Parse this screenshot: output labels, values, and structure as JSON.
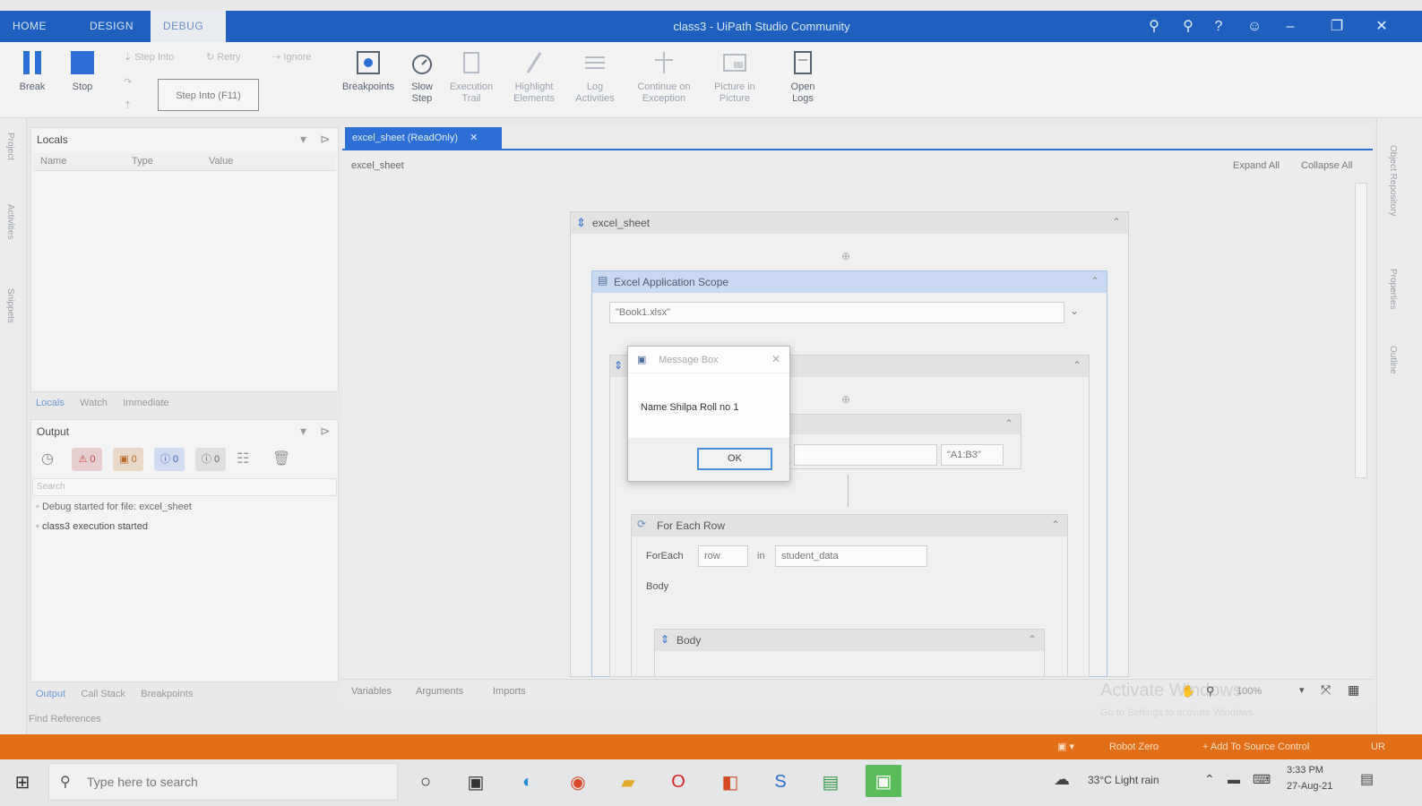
{
  "titlebar": {
    "tabs": [
      "HOME",
      "DESIGN",
      "DEBUG"
    ],
    "title": "class3 - UiPath Studio Community",
    "colors": {
      "bar": "#1f5fbf",
      "status": "#e26e17",
      "accent": "#2d6fd6"
    }
  },
  "ribbon": {
    "break_label": "Break",
    "stop_label": "Stop",
    "step_into": "Step Into",
    "retry": "Retry",
    "ignore": "Ignore",
    "tooltip": "Step Into (F11)",
    "breakpoints": "Breakpoints",
    "slow_step": [
      "Slow",
      "Step"
    ],
    "execution_trail": [
      "Execution",
      "Trail"
    ],
    "highlight_elements": [
      "Highlight",
      "Elements"
    ],
    "log_activities": [
      "Log",
      "Activities"
    ],
    "continue_on_exception": [
      "Continue on",
      "Exception"
    ],
    "picture_in_picture": [
      "Picture in",
      "Picture"
    ],
    "open_logs": [
      "Open",
      "Logs"
    ]
  },
  "left_strip": [
    "Project",
    "Activities",
    "Snippets"
  ],
  "right_strip": [
    "Object Repository",
    "Properties",
    "Outline"
  ],
  "locals": {
    "title": "Locals",
    "columns": [
      "Name",
      "Type",
      "Value"
    ],
    "tabs": [
      "Locals",
      "Watch",
      "Immediate"
    ]
  },
  "output": {
    "title": "Output",
    "counts": [
      "0",
      "0",
      "0",
      "0"
    ],
    "search_placeholder": "Search",
    "lines": [
      "Debug started for file: excel_sheet",
      "class3 execution started"
    ],
    "tabs": [
      "Output",
      "Call Stack",
      "Breakpoints"
    ],
    "find_references": "Find References"
  },
  "designer": {
    "doc_tab": "excel_sheet (ReadOnly)",
    "breadcrumb": "excel_sheet",
    "expand_all": "Expand All",
    "collapse_all": "Collapse All",
    "sequence_title": "excel_sheet",
    "scope_title": "Excel Application Scope",
    "workbook_path": "\"Book1.xlsx\"",
    "range_value": "\"A1:B3\"",
    "foreach_title": "For Each Row",
    "foreach_label": "ForEach",
    "foreach_var": "row",
    "in_label": "in",
    "foreach_collection": "student_data",
    "body_label": "Body",
    "body_seq_title": "Body",
    "bottom_tabs": [
      "Variables",
      "Arguments",
      "Imports"
    ],
    "zoom": "100%"
  },
  "dialog": {
    "title": "Message Box",
    "message": "Name Shilpa Roll no 1",
    "ok": "OK"
  },
  "activation": {
    "line1": "Activate Windows",
    "line2": "Go to Settings to activate Windows."
  },
  "statusbar": {
    "robot": "Robot Zero",
    "source_control": "+ Add To Source Control",
    "extra": "UR"
  },
  "taskbar": {
    "search_placeholder": "Type here to search",
    "weather": "33°C  Light rain",
    "time": "3:33 PM",
    "date": "27-Aug-21"
  }
}
